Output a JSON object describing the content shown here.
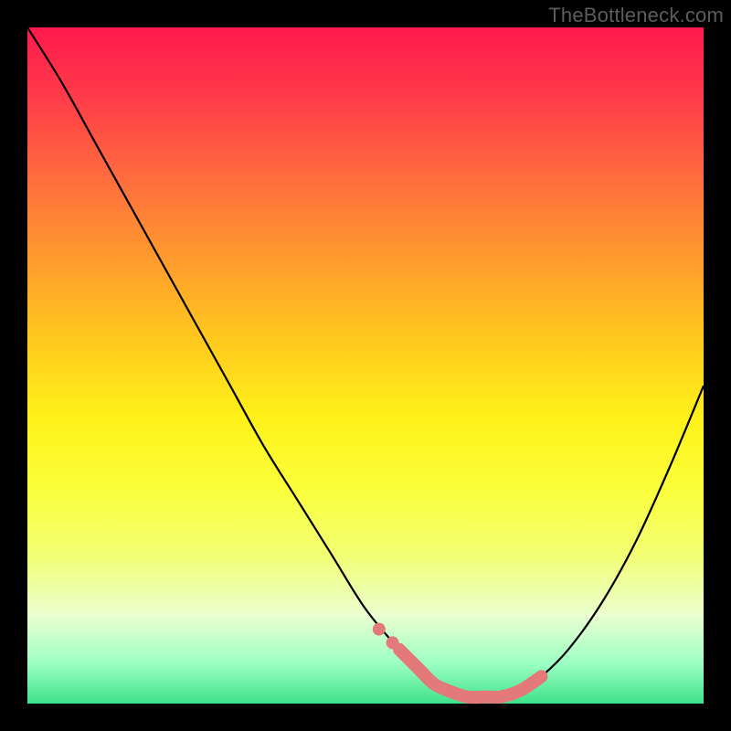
{
  "watermark": "TheBottleneck.com",
  "colors": {
    "background": "#000000",
    "curve": "#000000",
    "overlay": "#e37979",
    "gradient_top": "#ff1a4d",
    "gradient_bottom": "#3fe28b"
  },
  "chart_data": {
    "type": "line",
    "title": "",
    "xlabel": "",
    "ylabel": "",
    "xlim": [
      0,
      100
    ],
    "ylim": [
      0,
      100
    ],
    "series": [
      {
        "name": "bottleneck-curve",
        "x": [
          0,
          5,
          10,
          15,
          20,
          25,
          30,
          35,
          40,
          45,
          50,
          55,
          58,
          60,
          62,
          65,
          68,
          70,
          73,
          76,
          80,
          85,
          90,
          95,
          100
        ],
        "y": [
          100,
          92,
          83,
          74,
          65,
          56,
          47,
          38,
          30,
          22,
          14,
          8,
          5,
          3,
          2,
          1,
          1,
          1,
          2,
          4,
          8,
          15,
          24,
          35,
          47
        ]
      }
    ],
    "highlight": {
      "name": "optimal-zone",
      "x": [
        55,
        58,
        60,
        62,
        65,
        68,
        70,
        73,
        76
      ],
      "y": [
        8,
        5,
        3,
        2,
        1,
        1,
        1,
        2,
        4
      ]
    },
    "markers": [
      {
        "x": 52,
        "y": 11
      },
      {
        "x": 54,
        "y": 9
      }
    ]
  }
}
